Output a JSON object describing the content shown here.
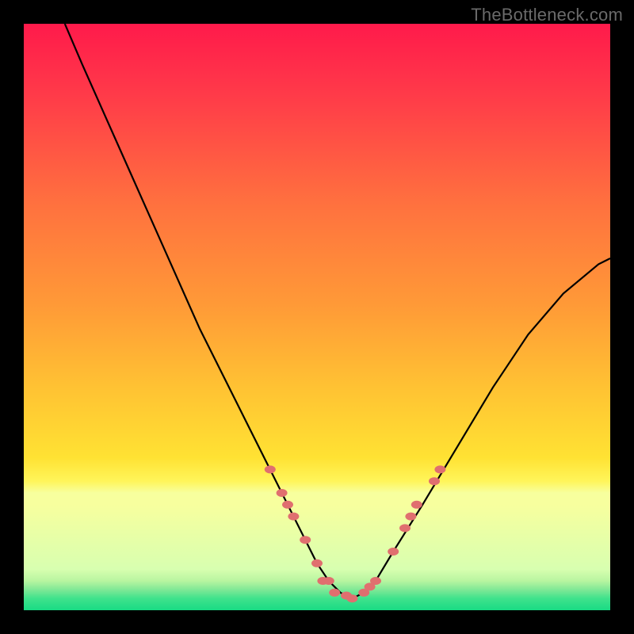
{
  "watermark": "TheBottleneck.com",
  "chart_data": {
    "type": "line",
    "title": "",
    "xlabel": "",
    "ylabel": "",
    "xlim": [
      0,
      100
    ],
    "ylim": [
      0,
      100
    ],
    "background_gradient": {
      "top": "#ff1a4b",
      "mid": "#ffcf33",
      "bottom_band": "#f7ff9e",
      "green": "#2fe08a"
    },
    "series": [
      {
        "name": "bottleneck-curve",
        "color": "#000000",
        "x": [
          7,
          10,
          14,
          18,
          22,
          26,
          30,
          34,
          38,
          42,
          44,
          46,
          48,
          50,
          52,
          54,
          56,
          58,
          60,
          63,
          68,
          74,
          80,
          86,
          92,
          98,
          100
        ],
        "y": [
          100,
          93,
          84,
          75,
          66,
          57,
          48,
          40,
          32,
          24,
          20,
          16,
          12,
          8,
          5,
          3,
          2,
          3,
          5,
          10,
          18,
          28,
          38,
          47,
          54,
          59,
          60
        ]
      }
    ],
    "markers": {
      "name": "highlighted-points",
      "color": "#e06f6f",
      "points": [
        {
          "x": 42,
          "y": 24
        },
        {
          "x": 44,
          "y": 20
        },
        {
          "x": 45,
          "y": 18
        },
        {
          "x": 46,
          "y": 16
        },
        {
          "x": 48,
          "y": 12
        },
        {
          "x": 50,
          "y": 8
        },
        {
          "x": 51,
          "y": 5
        },
        {
          "x": 52,
          "y": 5
        },
        {
          "x": 53,
          "y": 3
        },
        {
          "x": 55,
          "y": 2.5
        },
        {
          "x": 56,
          "y": 2
        },
        {
          "x": 58,
          "y": 3
        },
        {
          "x": 59,
          "y": 4
        },
        {
          "x": 60,
          "y": 5
        },
        {
          "x": 63,
          "y": 10
        },
        {
          "x": 65,
          "y": 14
        },
        {
          "x": 66,
          "y": 16
        },
        {
          "x": 67,
          "y": 18
        },
        {
          "x": 70,
          "y": 22
        },
        {
          "x": 71,
          "y": 24
        }
      ]
    }
  }
}
